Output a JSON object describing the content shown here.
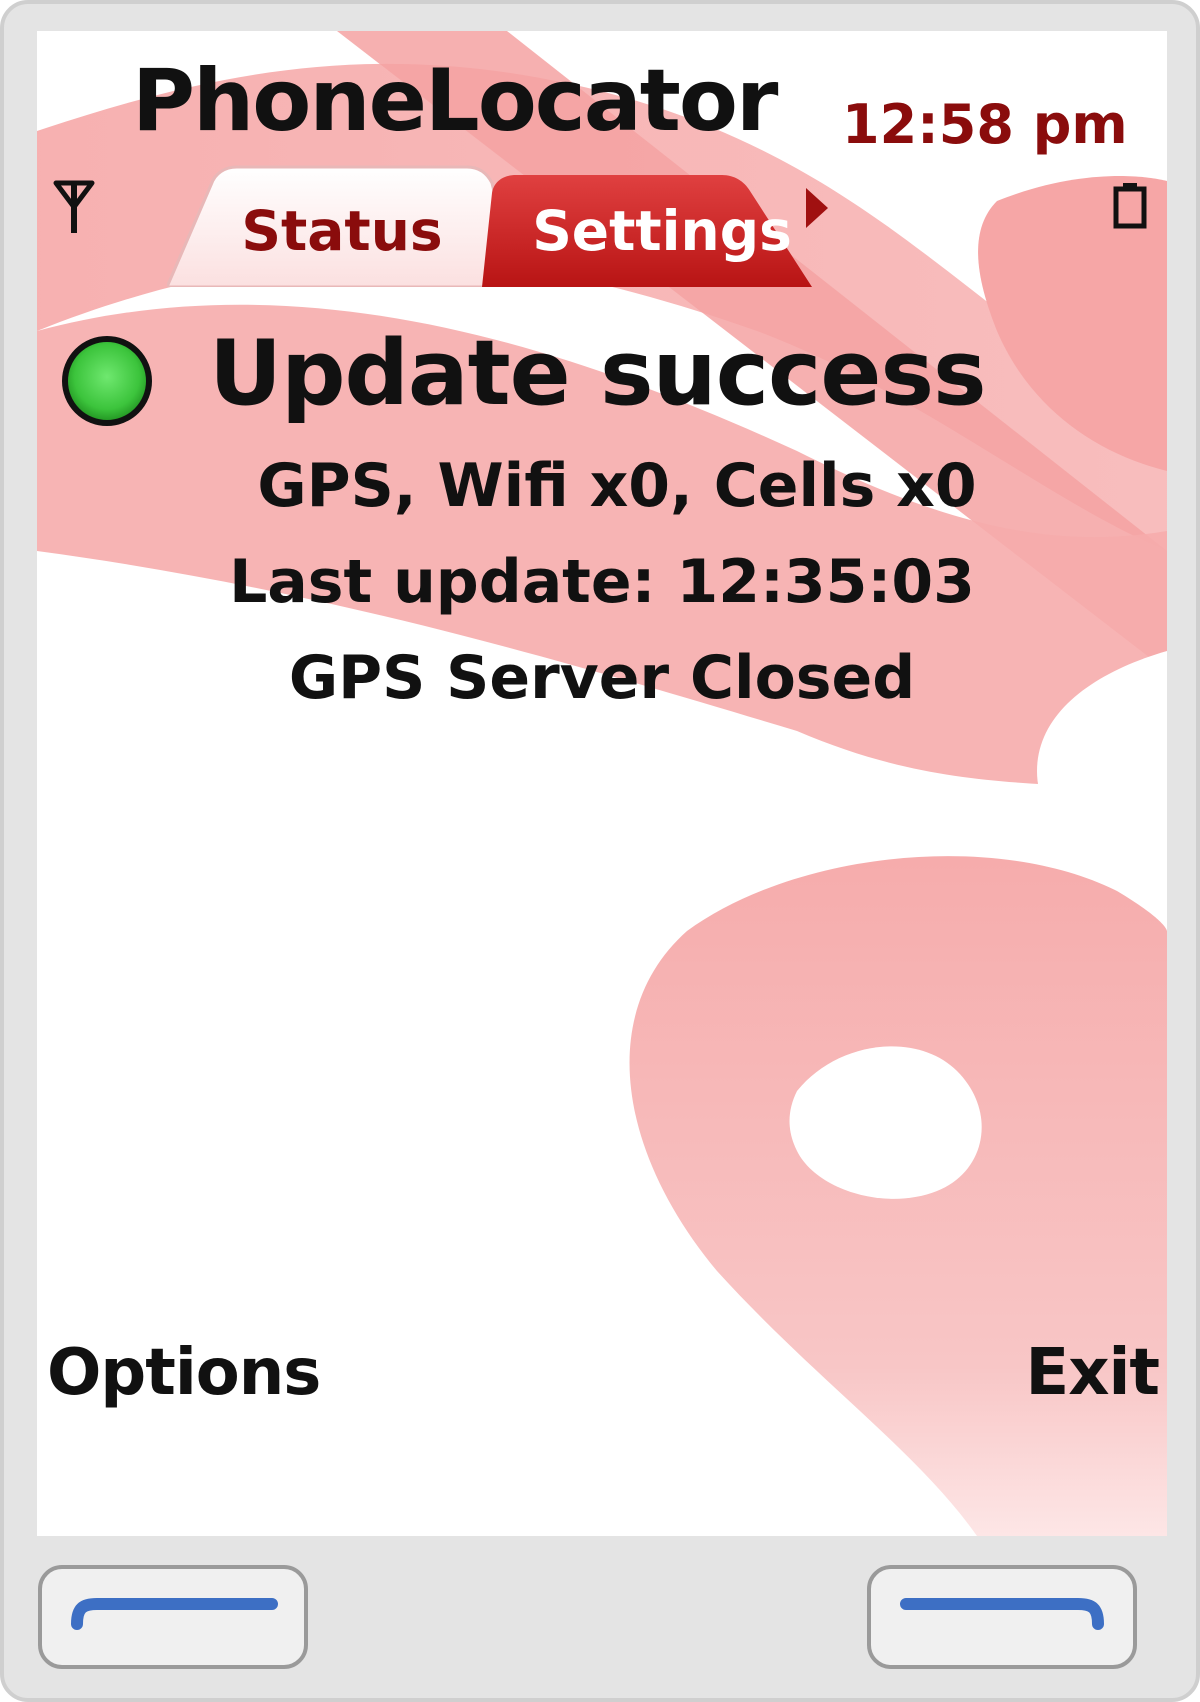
{
  "app": {
    "title": "PhoneLocator",
    "clock": "12:58 pm"
  },
  "tabs": [
    {
      "label": "Status",
      "active": true
    },
    {
      "label": "Settings",
      "active": false
    }
  ],
  "status": {
    "indicator_color": "#3cc43c",
    "title": "Update success",
    "lines": [
      "GPS, Wifi x0, Cells x0",
      "Last update: 12:35:03",
      "GPS Server Closed"
    ]
  },
  "softkeys": {
    "left": "Options",
    "right": "Exit"
  },
  "colors": {
    "accent_red": "#8a0c0c",
    "settings_tab": "#c91a1a",
    "wallpaper_pink": "#f7b4b4",
    "softkey_line": "#3d6fc4"
  },
  "icons": {
    "signal": "signal-antenna-icon",
    "battery": "battery-icon",
    "tab_scroll": "arrow-right-icon"
  }
}
